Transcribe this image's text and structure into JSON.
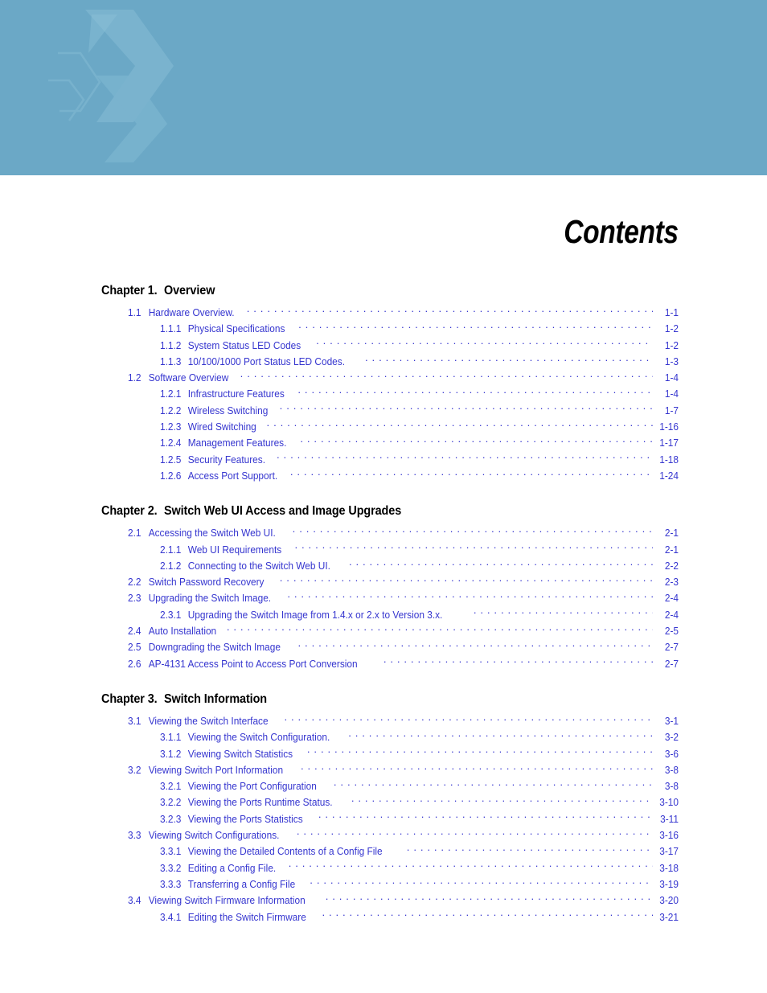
{
  "header": {
    "banner_color": "#6ba8c6",
    "watermark_color": "#7fb6d0",
    "watermark_icon": "chevron-logo-watermark"
  },
  "page": {
    "title": "Contents",
    "title_color": "#000000",
    "toc_link_color": "#3535cf"
  },
  "toc": {
    "chapters": [
      {
        "heading_number": "Chapter 1.",
        "heading_title": "Overview",
        "entries": [
          {
            "level": 1,
            "number": "1.1",
            "label": "Hardware Overview.",
            "page": "1-1"
          },
          {
            "level": 2,
            "number": "1.1.1",
            "label": "Physical Specifications",
            "page": "1-2"
          },
          {
            "level": 2,
            "number": "1.1.2",
            "label": "System Status LED Codes",
            "page": "1-2"
          },
          {
            "level": 2,
            "number": "1.1.3",
            "label": "10/100/1000 Port Status LED Codes.",
            "page": "1-3"
          },
          {
            "level": 1,
            "number": "1.2",
            "label": "Software Overview",
            "page": "1-4"
          },
          {
            "level": 2,
            "number": "1.2.1",
            "label": "Infrastructure Features",
            "page": "1-4"
          },
          {
            "level": 2,
            "number": "1.2.2",
            "label": "Wireless Switching",
            "page": "1-7"
          },
          {
            "level": 2,
            "number": "1.2.3",
            "label": "Wired Switching",
            "page": "1-16"
          },
          {
            "level": 2,
            "number": "1.2.4",
            "label": "Management Features.",
            "page": "1-17"
          },
          {
            "level": 2,
            "number": "1.2.5",
            "label": "Security Features.",
            "page": "1-18"
          },
          {
            "level": 2,
            "number": "1.2.6",
            "label": "Access Port Support.",
            "page": "1-24"
          }
        ]
      },
      {
        "heading_number": "Chapter 2.",
        "heading_title": "Switch Web UI Access and Image Upgrades",
        "entries": [
          {
            "level": 1,
            "number": "2.1",
            "label": "Accessing the Switch Web UI.",
            "page": "2-1"
          },
          {
            "level": 2,
            "number": "2.1.1",
            "label": "Web UI Requirements",
            "page": "2-1"
          },
          {
            "level": 2,
            "number": "2.1.2",
            "label": "Connecting to the Switch Web UI.",
            "page": "2-2"
          },
          {
            "level": 1,
            "number": "2.2",
            "label": "Switch Password Recovery",
            "page": "2-3"
          },
          {
            "level": 1,
            "number": "2.3",
            "label": "Upgrading the Switch Image.",
            "page": "2-4"
          },
          {
            "level": 2,
            "number": "2.3.1",
            "label": "Upgrading the Switch Image from 1.4.x or 2.x to Version 3.x.",
            "page": "2-4"
          },
          {
            "level": 1,
            "number": "2.4",
            "label": "Auto Installation",
            "page": "2-5"
          },
          {
            "level": 1,
            "number": "2.5",
            "label": "Downgrading the Switch Image",
            "page": "2-7"
          },
          {
            "level": 1,
            "number": "2.6",
            "label": "AP-4131 Access Point to Access Port Conversion",
            "page": "2-7"
          }
        ]
      },
      {
        "heading_number": "Chapter 3.",
        "heading_title": "Switch Information",
        "entries": [
          {
            "level": 1,
            "number": "3.1",
            "label": "Viewing the Switch Interface",
            "page": "3-1"
          },
          {
            "level": 2,
            "number": "3.1.1",
            "label": "Viewing the Switch Configuration.",
            "page": "3-2"
          },
          {
            "level": 2,
            "number": "3.1.2",
            "label": "Viewing Switch Statistics",
            "page": "3-6"
          },
          {
            "level": 1,
            "number": "3.2",
            "label": "Viewing Switch Port Information",
            "page": "3-8"
          },
          {
            "level": 2,
            "number": "3.2.1",
            "label": "Viewing the Port Configuration",
            "page": "3-8"
          },
          {
            "level": 2,
            "number": "3.2.2",
            "label": "Viewing the Ports Runtime Status.",
            "page": "3-10"
          },
          {
            "level": 2,
            "number": "3.2.3",
            "label": "Viewing the Ports Statistics",
            "page": "3-11"
          },
          {
            "level": 1,
            "number": "3.3",
            "label": "Viewing Switch Configurations.",
            "page": "3-16"
          },
          {
            "level": 2,
            "number": "3.3.1",
            "label": "Viewing the Detailed Contents of a Config File",
            "page": "3-17"
          },
          {
            "level": 2,
            "number": "3.3.2",
            "label": "Editing a Config File.",
            "page": "3-18"
          },
          {
            "level": 2,
            "number": "3.3.3",
            "label": "Transferring a Config File",
            "page": "3-19"
          },
          {
            "level": 1,
            "number": "3.4",
            "label": "Viewing Switch Firmware Information",
            "page": "3-20"
          },
          {
            "level": 2,
            "number": "3.4.1",
            "label": "Editing the Switch Firmware",
            "page": "3-21"
          }
        ]
      }
    ]
  }
}
